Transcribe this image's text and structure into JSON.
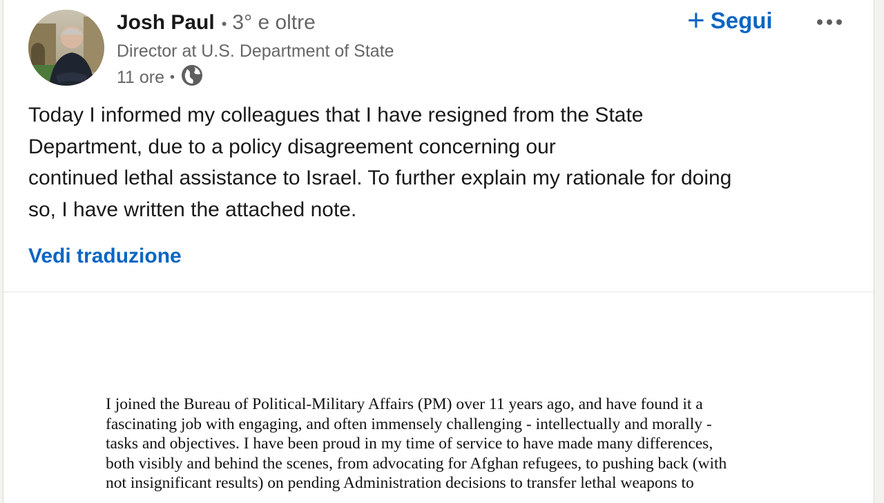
{
  "author": {
    "name": "Josh Paul",
    "degree": "3° e oltre",
    "headline": "Director at U.S. Department of State",
    "time": "11 ore",
    "separator": "•"
  },
  "actions": {
    "follow_plus": "+",
    "follow_label": "Segui"
  },
  "icons": {
    "visibility": "globe-icon",
    "more": "more-options-icon"
  },
  "post": {
    "lines": [
      "Today I informed my colleagues that I have resigned from the State",
      "Department, due to a policy disagreement concerning our",
      "continued lethal assistance to Israel. To further explain my rationale for doing",
      "so, I have written the attached note."
    ],
    "translate_label": "Vedi traduzione"
  },
  "document": {
    "lines": [
      "I joined the Bureau of Political-Military Affairs (PM) over 11 years ago, and have found it a",
      "fascinating job with engaging, and often immensely challenging - intellectually and morally -",
      "tasks and objectives.  I have been proud in my time of service to have made many differences,",
      "both visibly and behind the scenes, from advocating for Afghan refugees, to pushing back (with",
      "not insignificant results) on pending Administration decisions to transfer lethal weapons to"
    ]
  },
  "colors": {
    "link_blue": "#0a66c2",
    "text_primary": "#191919",
    "text_secondary": "#666666"
  }
}
